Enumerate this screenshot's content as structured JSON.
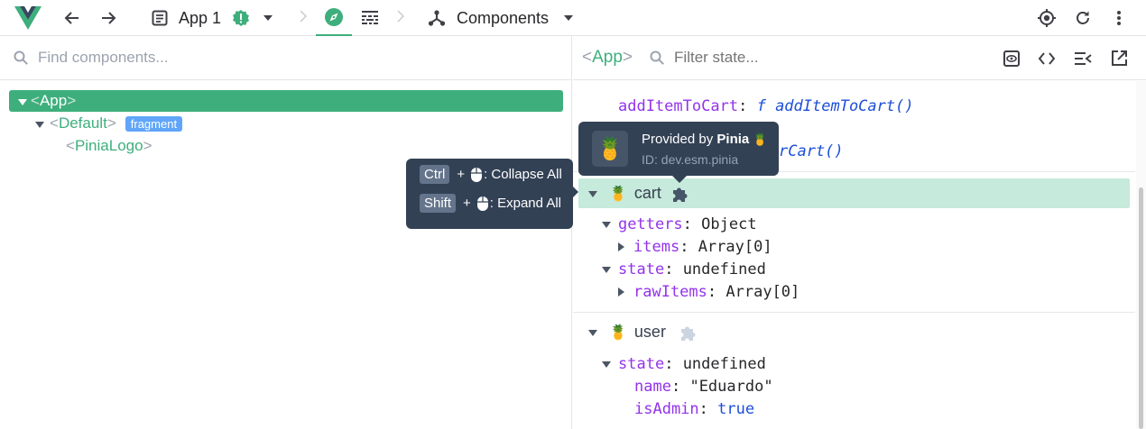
{
  "toolbar": {
    "app_name": "App 1",
    "view_label": "Components"
  },
  "tree": {
    "search_placeholder": "Find components...",
    "nodes": [
      {
        "lt": "<",
        "name": "App",
        "gt": ">"
      },
      {
        "lt": "<",
        "name": "Default",
        "gt": ">",
        "badge": "fragment"
      },
      {
        "lt": "<",
        "name": "PiniaLogo",
        "gt": ">"
      }
    ]
  },
  "inspector": {
    "component": {
      "lt": "<",
      "name": "App",
      "gt": ">"
    },
    "filter_placeholder": "Filter state...",
    "addItem": {
      "key": "addItemToCart",
      "colon": ":",
      "f": "f",
      "fn": "addItemToCart()"
    },
    "clear_fn_partial": "rCart()",
    "stores": [
      {
        "emoji": "🍍",
        "name": "cart",
        "getters": {
          "key": "getters",
          "colon": ":",
          "value": "Object"
        },
        "items": {
          "key": "items",
          "colon": ":",
          "value": "Array[0]"
        },
        "state": {
          "key": "state",
          "colon": ":",
          "value": "undefined"
        },
        "rawItems": {
          "key": "rawItems",
          "colon": ":",
          "value": "Array[0]"
        }
      },
      {
        "emoji": "🍍",
        "name": "user",
        "state": {
          "key": "state",
          "colon": ":",
          "value": "undefined"
        },
        "fields": [
          {
            "key": "name",
            "colon": ":",
            "value": "\"Eduardo\""
          },
          {
            "key": "isAdmin",
            "colon": ":",
            "value": "true"
          }
        ]
      }
    ]
  },
  "tooltip_provided": {
    "prefix": "Provided by ",
    "plugin": "Pinia",
    "plugin_emoji": "🍍",
    "logo_emoji": "🍍",
    "id": "ID: dev.esm.pinia"
  },
  "tooltip_keys": {
    "row1": {
      "key": "Ctrl",
      "plus": "+",
      "action": ": Collapse All"
    },
    "row2": {
      "key": "Shift",
      "plus": "+",
      "action": ": Expand All"
    }
  },
  "colors": {
    "accent": "#3eaf7c",
    "selected_store_bg": "#c6eadb",
    "tooltip_bg": "#334155",
    "key": "#9333ea"
  },
  "icons": {
    "vue_logo": "vue-logo-icon",
    "back": "arrow-left-icon",
    "forward": "arrow-right-icon",
    "app": "app-window-icon",
    "warning": "warning-badge-icon",
    "inspector": "compass-icon",
    "timeline": "timeline-icon",
    "components": "component-tree-icon",
    "select": "target-icon",
    "refresh": "refresh-icon",
    "menu": "more-vertical-icon",
    "search": "search-icon",
    "eye": "eye-icon",
    "code": "code-icon",
    "flatten": "flatten-icon",
    "external": "open-external-icon",
    "puzzle": "puzzle-icon",
    "mouse": "mouse-icon"
  }
}
